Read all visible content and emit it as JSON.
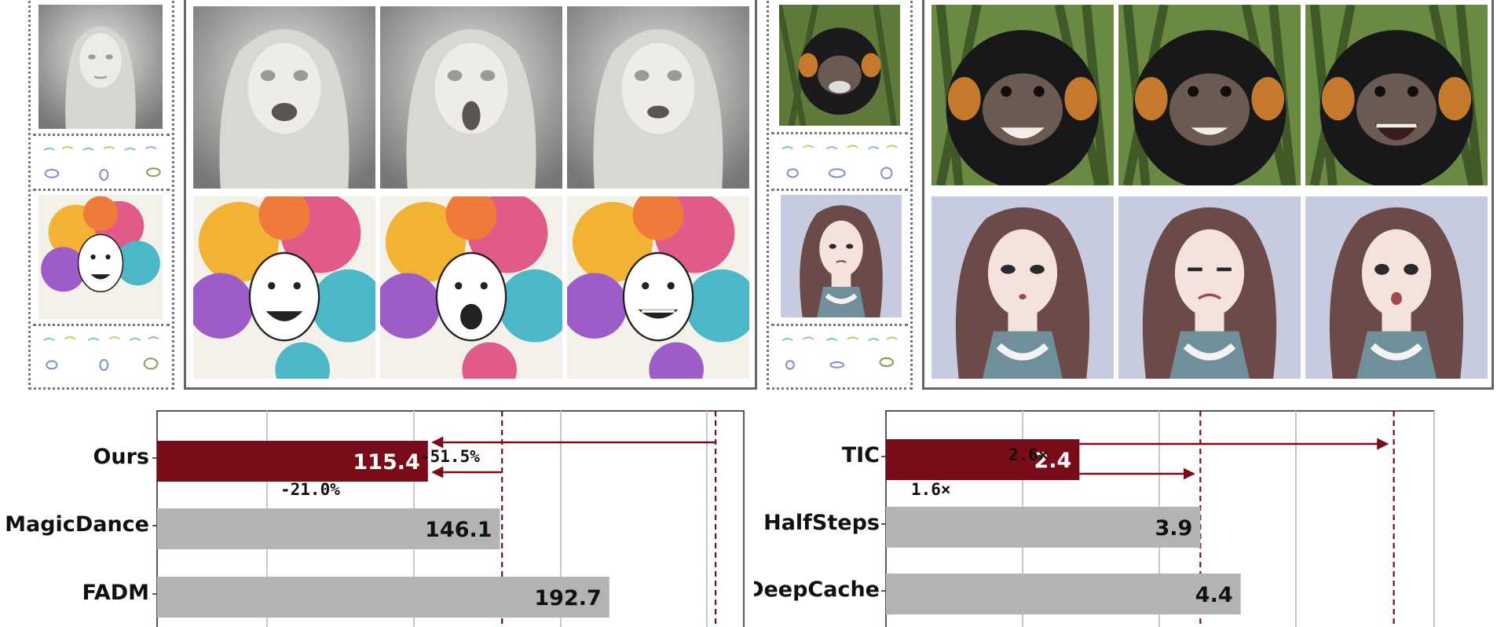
{
  "chart_data": [
    {
      "type": "bar",
      "orientation": "horizontal",
      "categories": [
        "Ours",
        "MagicDance",
        "FADM"
      ],
      "values": [
        115.4,
        146.1,
        192.7
      ],
      "value_labels": [
        "115.4",
        "146.1",
        "192.7"
      ],
      "highlight": "Ours",
      "xlim": [
        0,
        250
      ],
      "reference_lines": [
        147,
        238
      ],
      "annotations": [
        "-51.5%",
        "-21.0%"
      ],
      "colors": {
        "highlight": "#7a0c1a",
        "bar": "#b3b3b3",
        "grid": "#c8c8c8"
      }
    },
    {
      "type": "bar",
      "orientation": "horizontal",
      "categories": [
        "TIC",
        "HalfSteps",
        "DeepCache"
      ],
      "values": [
        2.4,
        3.9,
        4.4
      ],
      "value_labels": [
        "2.4",
        "3.9",
        "4.4"
      ],
      "highlight": "TIC",
      "xlim": [
        0,
        6.8
      ],
      "reference_lines": [
        3.9,
        6.3
      ],
      "annotations": [
        "2.6×",
        "1.6×"
      ],
      "colors": {
        "highlight": "#7a0c1a",
        "bar": "#b3b3b3",
        "grid": "#c8c8c8"
      }
    }
  ],
  "figures": {
    "left_group": {
      "reference_images": [
        "statue-reference",
        "colorful-woman-reference"
      ],
      "generated_rows": [
        [
          "statue-surprised-1",
          "statue-surprised-2",
          "statue-surprised-3"
        ],
        [
          "colorful-woman-laugh-1",
          "colorful-woman-laugh-2",
          "colorful-woman-laugh-3"
        ]
      ]
    },
    "right_group": {
      "reference_images": [
        "monkey-reference",
        "cartoon-woman-reference"
      ],
      "generated_rows": [
        [
          "monkey-grin-1",
          "monkey-grin-2",
          "monkey-grin-3"
        ],
        [
          "cartoon-woman-frown-1",
          "cartoon-woman-frown-2",
          "cartoon-woman-frown-3"
        ]
      ]
    }
  }
}
